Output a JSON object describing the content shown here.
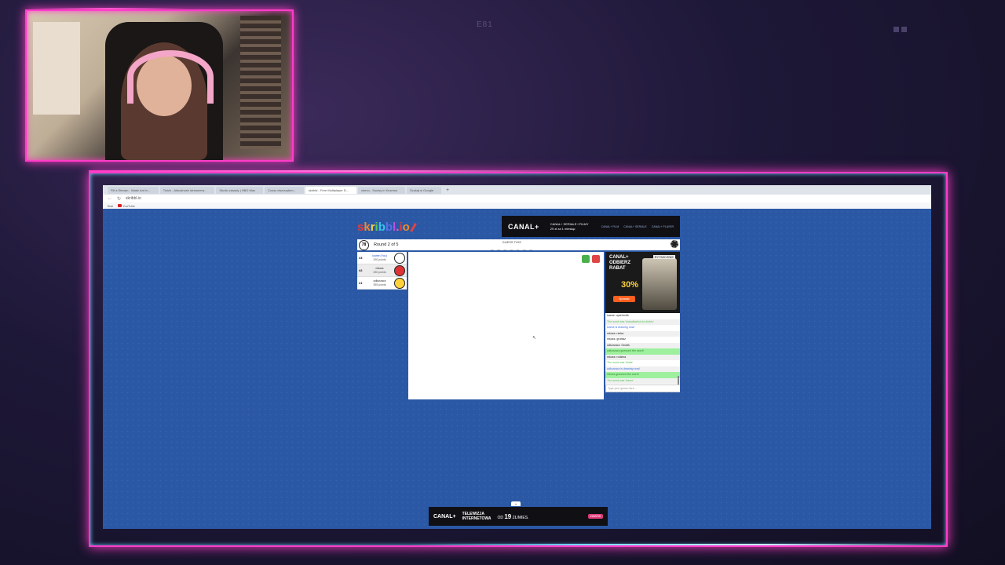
{
  "overlay": {
    "code": "E81"
  },
  "browser": {
    "tabs": [
      {
        "label": "Fill a Stream - Wake Ant In...",
        "active": false
      },
      {
        "label": "Twich - Aktualność streamera...",
        "active": false
      },
      {
        "label": "Studio zasady | HBO Max",
        "active": false
      },
      {
        "label": "Czosz otworzyłem...",
        "active": false
      },
      {
        "label": "skribbl - Free Multiplayer D...",
        "active": true
      },
      {
        "label": "xdevo - Soulsy in Kosmos",
        "active": false
      },
      {
        "label": "Szukaj w Google",
        "active": false
      }
    ],
    "url": "skribbl.io",
    "bookmarks": [
      "Bob",
      "YouTube"
    ]
  },
  "game": {
    "logo": [
      "s",
      "k",
      "r",
      "i",
      "b",
      "b",
      "l",
      ".",
      "i",
      "o"
    ],
    "timer": "78",
    "round_label": "Round 2 of 5",
    "guess_label": "GUESS THIS",
    "word_blanks": "_ _ _ _ _ _ _",
    "word_length": "6",
    "players": [
      {
        "rank": "#3",
        "name": "icame (You)",
        "points": "290 points",
        "you": true
      },
      {
        "rank": "#2",
        "name": "mkoss",
        "points": "330 points",
        "you": false
      },
      {
        "rank": "#1",
        "name": "odkurzacz",
        "points": "355 points",
        "you": false
      }
    ],
    "chat": [
      {
        "text": "icame: opal krulik",
        "style": "c-black"
      },
      {
        "text": "The word was 'krasalkanka do drobiu'",
        "style": "c-green"
      },
      {
        "text": "icame is drawing now!",
        "style": "c-blue"
      },
      {
        "text": "mkoss: rzeka",
        "style": "c-black"
      },
      {
        "text": "mkoss: grubisz",
        "style": "c-black"
      },
      {
        "text": "odkurzacz: Grubik",
        "style": "c-black"
      },
      {
        "text": "odkurzacz guessed the word!",
        "style": "c-greenbg"
      },
      {
        "text": "mkoss: rodzina",
        "style": "c-black"
      },
      {
        "text": "The word was 'foldis'",
        "style": "c-green"
      },
      {
        "text": "odkurzacz is drawing now!",
        "style": "c-blue"
      },
      {
        "text": "mkoss guessed the word!",
        "style": "c-greenbg"
      },
      {
        "text": "The word was 'frame'",
        "style": "c-green"
      },
      {
        "text": "mkoss is drawing now!",
        "style": "c-blue"
      }
    ],
    "chat_placeholder": "Type your guess here..."
  },
  "ads": {
    "top": {
      "brand": "CANAL+",
      "line1": "CANAL+ SERIALE I FILMY",
      "line2": "29 zł za 1 miesiąc",
      "logos": [
        "CANAL+ FILM",
        "CANAL+ SERIALE",
        "CANAL+ PLAYER"
      ]
    },
    "side": {
      "brand": "CANAL+",
      "line1": "ODBIERZ",
      "line2": "RABAT",
      "percent": "30%",
      "button": "Sprawdź",
      "tag": "RYTMICZNIE"
    },
    "bottom": {
      "brand": "CANAL+",
      "line1": "TELEWIZJA",
      "line2": "INTERNETOWA",
      "price_prefix": "OD",
      "price": "19",
      "price_suffix": "ZŁ/MIES.",
      "button": "ZAMÓW"
    }
  },
  "colors": {
    "neon_pink": "#ff3cc8",
    "neon_blue": "#6ad0ff",
    "page_blue": "#2b58a5"
  }
}
